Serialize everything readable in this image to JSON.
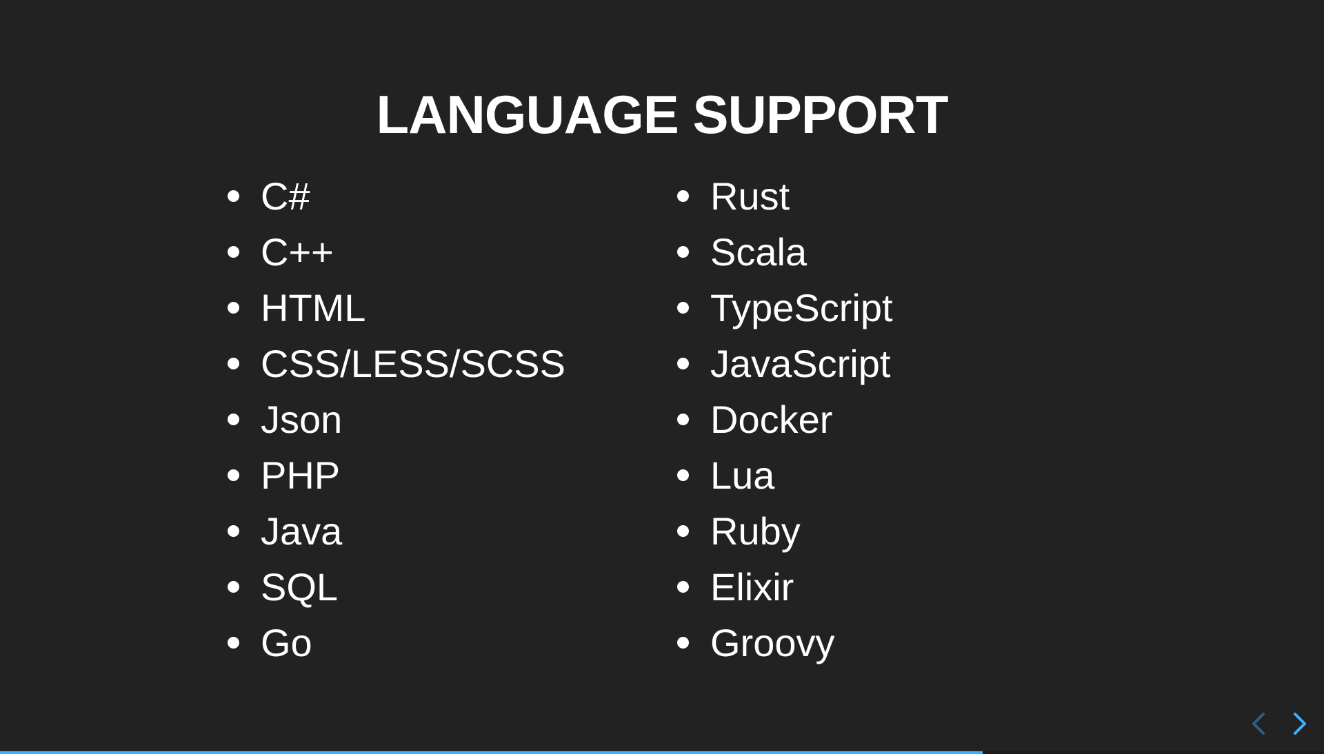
{
  "slide": {
    "title": "LANGUAGE SUPPORT",
    "left_column": [
      "C#",
      "C++",
      "HTML",
      "CSS/LESS/SCSS",
      "Json",
      "PHP",
      "Java",
      "SQL",
      "Go"
    ],
    "right_column": [
      "Rust",
      "Scala",
      "TypeScript",
      "JavaScript",
      "Docker",
      "Lua",
      "Ruby",
      "Elixir",
      "Groovy"
    ]
  },
  "controls": {
    "prev_icon": "chevron-left-icon",
    "next_icon": "chevron-right-icon",
    "prev_color": "#2a5f8a",
    "next_color": "#42affa"
  },
  "progress": {
    "fraction": 0.742,
    "color": "#42affa"
  },
  "colors": {
    "background": "#222222",
    "text": "#ffffff"
  }
}
